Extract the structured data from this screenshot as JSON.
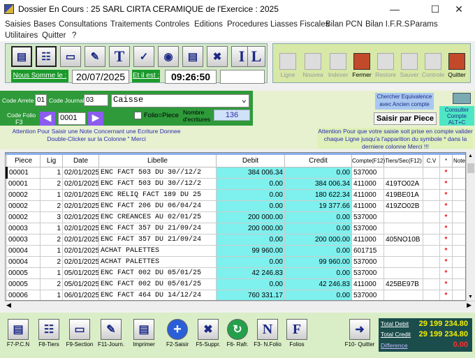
{
  "window": {
    "title": "Dossier En Cours : 25 SARL CIRTA CERAMIQUE  de l'Exercice : 2025"
  },
  "menu": [
    "Saisies",
    "Bases",
    "Consultations",
    "Traitements",
    "Controles",
    "Editions",
    "Procedures",
    "Liasses Fiscales",
    "Bilan PCN",
    "Bilan I.F.R.S",
    "Params",
    "Utilitaires",
    "Quitter",
    "?"
  ],
  "header": {
    "nous_somme_label": "Nous Somme le :",
    "date": "20/07/2025",
    "et_il_est_label": "Et il est :",
    "time": "09:26:50"
  },
  "toolbar1_letters": [
    "T",
    "I",
    "L"
  ],
  "toolbar2": [
    "Ligne",
    "Nouvea",
    "Indexer",
    "Fermer",
    "Restore",
    "Sauver",
    "Controle",
    "Quitter"
  ],
  "form": {
    "code_arrete_label": "Code Arrete",
    "code_arrete": "01",
    "code_journal_label": "Code Journal",
    "code_journal": "03",
    "journal_name": "Caisse",
    "code_folio_label": "Code Folio",
    "code_folio_key": "F3",
    "folio": "0001",
    "folio_piece_label": "Folio=Piece",
    "nombre_ecritures_label": "Nombre d'ecritures",
    "nombre_ecritures": "136",
    "chercher_equiv": "Chercher Equivalence avec Ancien compte",
    "saisir_par_piece": "Saisir par Piece",
    "consulter_compte": "Consulter Compte ALT+C",
    "attention_left": "Attention  Pour  Saisir une Note Concernant une Ecriture Donnee Double-Clicker sur la Colonne \" Merci",
    "attention_right": "Attention  Pour que votre saisie soit prise en compte valider chaque Ligne jusqu'a l'apparition du symbole * dans la derniere colonne Merci !!!"
  },
  "grid": {
    "headers": [
      "Piece",
      "Lig",
      "Date",
      "Libelle",
      "Debit",
      "Credit",
      "Compte(F12)",
      "Tiers/Sec(F12)",
      "C.V",
      "*",
      "Note"
    ],
    "rows": [
      [
        "00001",
        "1",
        "02/01/2025",
        "ENC FACT 503 DU 30//12/2",
        "384 006.34",
        "0.00",
        "537000",
        "",
        "",
        "*",
        ""
      ],
      [
        "00001",
        "2",
        "02/01/2025",
        "ENC FACT 503 DU 30//12/2",
        "0.00",
        "384 006.34",
        "411000",
        "419TO02A",
        "",
        "*",
        ""
      ],
      [
        "00002",
        "1",
        "02/01/2025",
        "ENC RELIQ FACT 189 DU 25",
        "0.00",
        "180 622.34",
        "411000",
        "419BE01A",
        "",
        "*",
        ""
      ],
      [
        "00002",
        "2",
        "02/01/2025",
        "ENC FACT 206 DU 06/04/24",
        "0.00",
        "19 377.66",
        "411000",
        "419ZO02B",
        "",
        "*",
        ""
      ],
      [
        "00002",
        "3",
        "02/01/2025",
        "ENC CREANCES AU 02/01/25",
        "200 000.00",
        "0.00",
        "537000",
        "",
        "",
        "*",
        ""
      ],
      [
        "00003",
        "1",
        "02/01/2025",
        "ENC FACT 357 DU 21/09/24",
        "200 000.00",
        "0.00",
        "537000",
        "",
        "",
        "*",
        ""
      ],
      [
        "00003",
        "2",
        "02/01/2025",
        "ENC FACT 357 DU 21/09/24",
        "0.00",
        "200 000.00",
        "411000",
        "405NO10B",
        "",
        "*",
        ""
      ],
      [
        "00004",
        "1",
        "02/01/2025",
        "ACHAT PALETTES",
        "99 960.00",
        "0.00",
        "601715",
        "",
        "",
        "*",
        ""
      ],
      [
        "00004",
        "2",
        "02/01/2025",
        "ACHAT PALETTES",
        "0.00",
        "99 960.00",
        "537000",
        "",
        "",
        "*",
        ""
      ],
      [
        "00005",
        "1",
        "05/01/2025",
        "ENC FACT 002 DU 05/01/25",
        "42 246.83",
        "0.00",
        "537000",
        "",
        "",
        "*",
        ""
      ],
      [
        "00005",
        "2",
        "05/01/2025",
        "ENC FACT 002 DU 05/01/25",
        "0.00",
        "42 246.83",
        "411000",
        "425BE97B",
        "",
        "*",
        ""
      ],
      [
        "00006",
        "1",
        "06/01/2025",
        "ENC FACT 464 DU 14/12/24",
        "760 331.17",
        "0.00",
        "537000",
        "",
        "",
        "*",
        ""
      ]
    ]
  },
  "bottom_buttons": [
    "F7-P.C.N",
    "F8-Tiers",
    "F9-Section",
    "F11-Journ.",
    "Imprimer",
    "F2-Saisir",
    "F5-Suppr.",
    "F6- Rafr.",
    "F3- N.Folio",
    "Folios",
    "F10- Quitter"
  ],
  "bottom_letters": {
    "n": "N",
    "f": "F"
  },
  "totals": {
    "total_debit_label": "Total Debit",
    "total_debit": "29 199 234.80",
    "total_credit_label": "Total Credit",
    "total_credit": "29 199 234.80",
    "difference_label": "Difference",
    "difference": "0.00"
  }
}
